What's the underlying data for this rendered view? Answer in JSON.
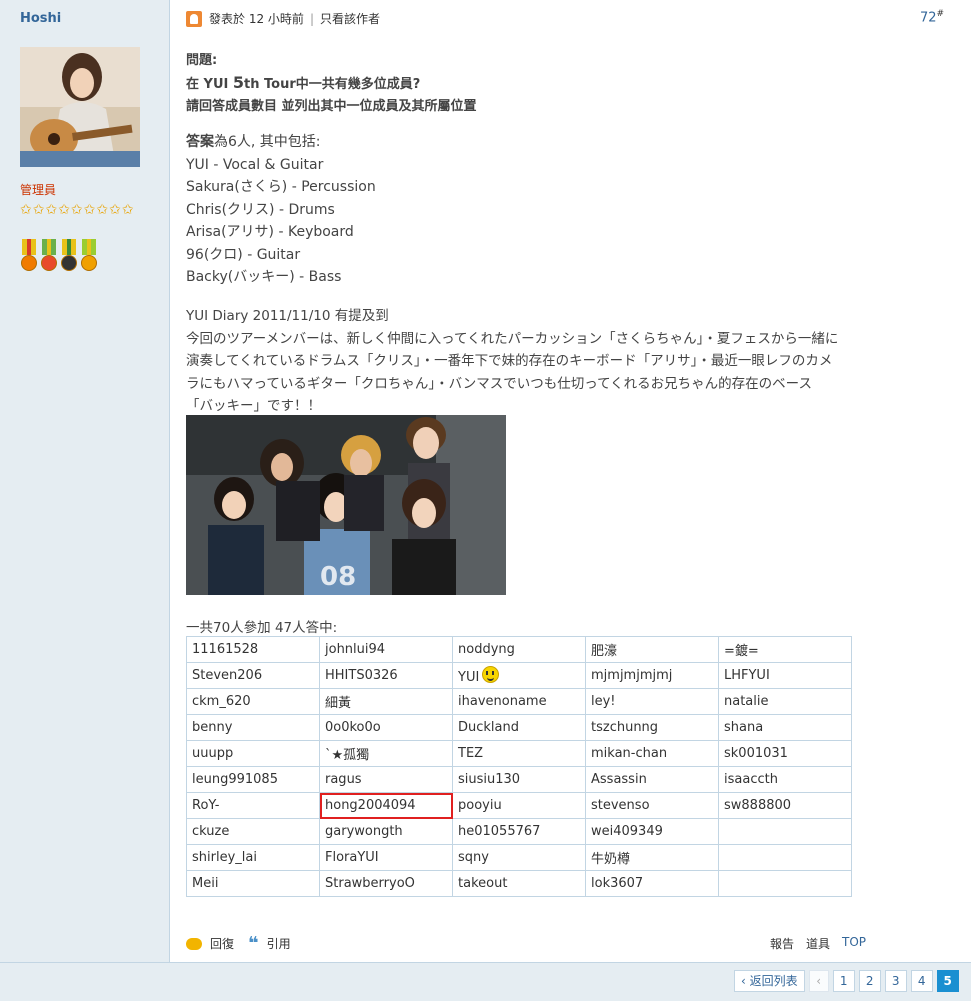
{
  "author": {
    "name": "Hoshi",
    "role": "管理員",
    "stars": "✩✩✩✩✩✩✩✩✩",
    "medal_count": 4
  },
  "post": {
    "meta_prefix": "發表於",
    "meta_time": "12 小時前",
    "meta_separator": "|",
    "only_author": "只看該作者",
    "floor_number": "72",
    "floor_symbol": "#",
    "question_label": "問題:",
    "question_line1_a": "在 YUI ",
    "question_line1_b": "5",
    "question_line1_c": "th Tour中一共有幾多位成員?",
    "question_line2": "請回答成員數目 並列出其中一位成員及其所屬位置",
    "answer_lead": "答案",
    "answer_text": "為6人, 其中包括:",
    "members": [
      "YUI - Vocal & Guitar",
      "Sakura(さくら) - Percussion",
      "Chris(クリス) - Drums",
      "Arisa(アリサ) - Keyboard",
      "96(クロ) - Guitar",
      "Backy(バッキー) - Bass"
    ],
    "diary_title": "YUI Diary 2011/11/10 有提及到",
    "diary_lines": [
      "今回のツアーメンバーは、新しく仲間に入ってくれたパーカッション「さくらちゃん」・夏フェスから一緒に",
      "演奏してくれているドラムス「クリス」・一番年下で妹的存在のキーボード「アリサ」・最近一眼レフのカメ",
      "ラにもハマっているギター「クロちゃん」・バンマスでいつも仕切ってくれるお兄ちゃん的存在のベース",
      "「バッキー」です！！"
    ],
    "participants_summary": "一共70人參加 47人答中:",
    "participants": [
      [
        "11161528",
        "johnlui94",
        "noddyng",
        "肥濠",
        "=鍍="
      ],
      [
        "Steven206",
        "HHITS0326",
        "YUI",
        "mjmjmjmjmj",
        "LHFYUI"
      ],
      [
        "ckm_620",
        "細黃",
        "ihavenoname",
        "ley!",
        "natalie"
      ],
      [
        "benny",
        "0o0ko0o",
        "Duckland",
        "tszchunng",
        "shana"
      ],
      [
        "uuupp",
        "`★孤獨",
        "TEZ",
        "mikan-chan",
        "sk001031"
      ],
      [
        "leung991085",
        "ragus",
        "siusiu130",
        "Assassin",
        "isaaccth"
      ],
      [
        "RoY-",
        "hong2004094",
        "pooyiu",
        "stevenso",
        "sw888800"
      ],
      [
        "ckuze",
        "garywongth",
        "he01055767",
        "wei409349",
        ""
      ],
      [
        "shirley_lai",
        "FloraYUI",
        "sqny",
        "牛奶樽",
        ""
      ],
      [
        "Meii",
        "StrawberryoO",
        "takeout",
        "lok3607",
        ""
      ]
    ],
    "highlighted_participant": "hong2004094"
  },
  "actions": {
    "reply": "回復",
    "quote": "引用",
    "report": "報告",
    "tools": "道具",
    "top": "TOP"
  },
  "pager": {
    "back": "返回列表",
    "pages": [
      "1",
      "2",
      "3",
      "4"
    ],
    "current": "5"
  },
  "colors": {
    "sidebar_bg": "#e5edf2",
    "border": "#c2d5e3",
    "link": "#336699",
    "highlight": "#e02020",
    "current_page": "#1a8fd1"
  }
}
